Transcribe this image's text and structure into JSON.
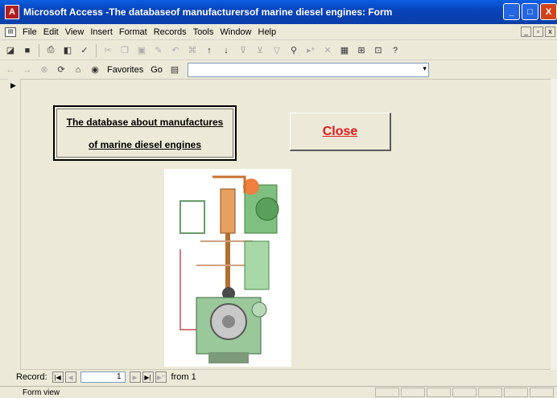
{
  "window": {
    "title": "Microsoft Access -The databaseof manufacturersof marine diesel engines: Form",
    "app_icon": "access-icon",
    "controls": [
      "_",
      "□",
      "X"
    ]
  },
  "menubar": {
    "items": [
      "File",
      "Edit",
      "View",
      "Insert",
      "Format",
      "Records",
      "Tools",
      "Window",
      "Help"
    ]
  },
  "toolbar2": {
    "favorites_label": "Favorites",
    "go_label": "Go"
  },
  "form": {
    "title_line1": "The database about manufactures",
    "title_line2": "of marine diesel engines",
    "close_label": "Close",
    "colors": {
      "close_text": "#e01818"
    }
  },
  "navigation": {
    "record_label": "Record:",
    "current_record": "1",
    "of_text": "from 1"
  },
  "status": {
    "text": "Form view"
  }
}
